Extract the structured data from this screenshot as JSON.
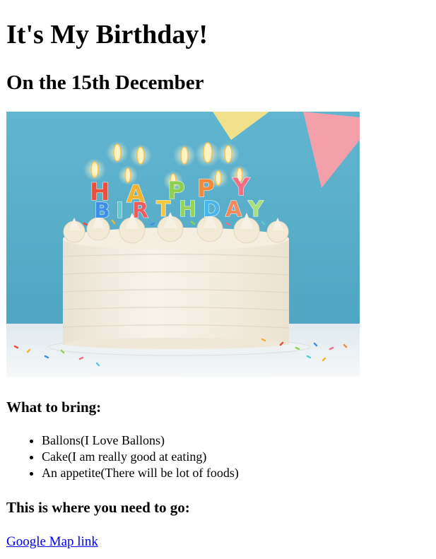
{
  "page": {
    "title": "It's My Birthday!",
    "subtitle": "On the 15th December"
  },
  "image": {
    "candle_letters": {
      "line1": [
        "H",
        "A",
        "P",
        "P",
        "Y"
      ],
      "line2": [
        "B",
        "I",
        "R",
        "T",
        "H",
        "D",
        "A",
        "Y"
      ]
    }
  },
  "bring": {
    "heading": "What to bring:",
    "items": [
      "Ballons(I Love Ballons)",
      "Cake(I am really good at eating)",
      "An appetite(There will be lot of foods)"
    ]
  },
  "directions": {
    "heading": "This is where you need to go:",
    "link_text": "Google Map link"
  },
  "colors": {
    "link": "#0000ee",
    "sky_blue": "#5bb0cc",
    "pennant_yellow": "#f1e18b",
    "pennant_pink": "#f4a0aa"
  }
}
